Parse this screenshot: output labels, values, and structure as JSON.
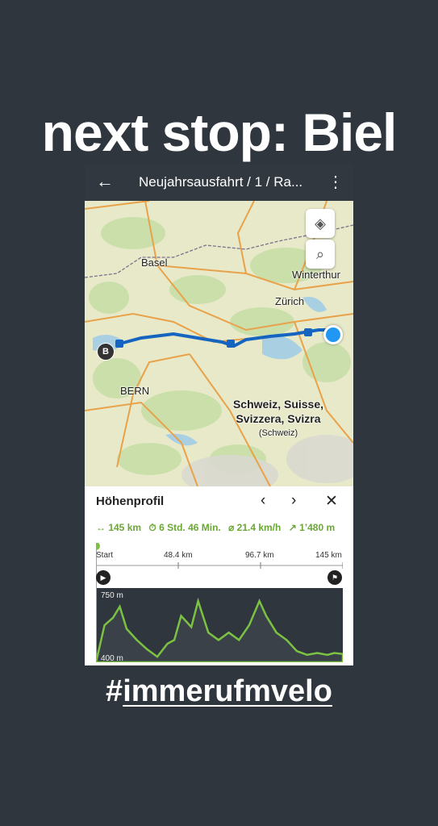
{
  "story": {
    "headline": "next stop: Biel",
    "hashtag_prefix": "#",
    "hashtag_text": "immerufmvelo"
  },
  "appbar": {
    "back_icon": "arrow-left-icon",
    "title": "Neujahrsausfahrt / 1 / Ra...",
    "more_icon": "more-vertical-icon"
  },
  "map": {
    "layers_icon": "layers-icon",
    "search_icon": "search-icon",
    "cities": {
      "basel": "Basel",
      "winterthur": "Winterthur",
      "zurich": "Zürich",
      "bern": "BERN"
    },
    "country_label_lines": [
      "Schweiz, Suisse,",
      "Svizzera, Svizra"
    ],
    "country_sub": "(Schweiz)",
    "marker_b": "B",
    "route_color": "#1565c0"
  },
  "profile": {
    "title": "Höhenprofil",
    "prev_icon": "chevron-left-icon",
    "next_icon": "chevron-right-icon",
    "close_icon": "close-icon",
    "stats": {
      "distance": "↔ 145 km",
      "duration": "⏱ 6 Std. 46 Min.",
      "speed": "⌀ 21.4 km/h",
      "ascent": "↗ 1’480 m"
    },
    "scale_labels": [
      "Start",
      "48.4 km",
      "96.7 km",
      "145 km"
    ],
    "y_labels": {
      "top": "750 m",
      "bottom": "400 m"
    },
    "accent": "#6aa834"
  },
  "chart_data": {
    "type": "area",
    "xlabel": "",
    "ylabel": "",
    "x_ticks": [
      "Start",
      "48.4 km",
      "96.7 km",
      "145 km"
    ],
    "ylim": [
      400,
      800
    ],
    "x": [
      0,
      5,
      10,
      14,
      18,
      24,
      30,
      36,
      42,
      46,
      50,
      56,
      60,
      66,
      72,
      78,
      84,
      90,
      96,
      100,
      106,
      112,
      118,
      124,
      130,
      136,
      140,
      145
    ],
    "y": [
      400,
      600,
      640,
      700,
      580,
      520,
      470,
      430,
      500,
      520,
      650,
      590,
      730,
      560,
      520,
      560,
      520,
      600,
      730,
      650,
      560,
      520,
      460,
      440,
      450,
      440,
      450,
      445
    ]
  }
}
